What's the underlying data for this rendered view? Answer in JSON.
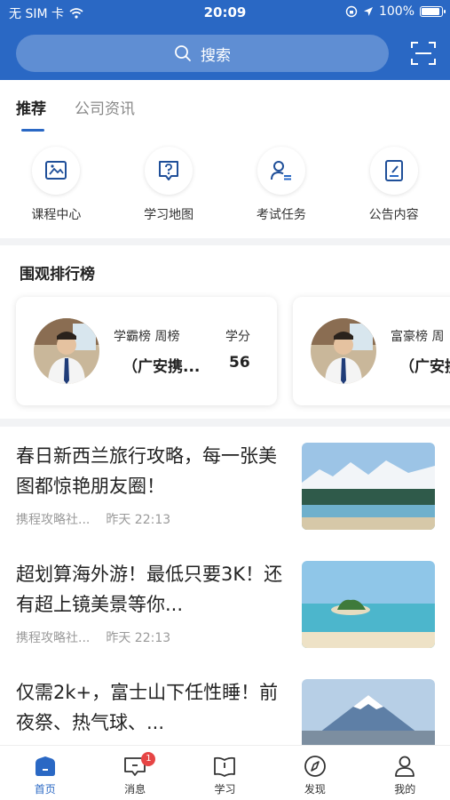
{
  "status_bar": {
    "carrier": "无 SIM 卡",
    "time": "20:09",
    "battery": "100%"
  },
  "search": {
    "label": "搜索"
  },
  "tabs": [
    {
      "label": "推荐",
      "active": true
    },
    {
      "label": "公司资讯",
      "active": false
    }
  ],
  "quick_actions": [
    {
      "label": "课程中心",
      "icon": "image-icon"
    },
    {
      "label": "学习地图",
      "icon": "question-icon"
    },
    {
      "label": "考试任务",
      "icon": "user-list-icon"
    },
    {
      "label": "公告内容",
      "icon": "edit-icon"
    }
  ],
  "ranking": {
    "title": "围观排行榜",
    "cards": [
      {
        "label": "学霸榜 周榜",
        "name": "（广安携...",
        "score_label": "学分",
        "score": "56"
      },
      {
        "label": "富豪榜 周",
        "name": "（广安携"
      }
    ]
  },
  "articles": [
    {
      "title": "春日新西兰旅行攻略，每一张美图都惊艳朋友圈！",
      "source": "携程攻略社...",
      "time": "昨天 22:13"
    },
    {
      "title": "超划算海外游！最低只要3K！还有超上镜美景等你...",
      "source": "携程攻略社...",
      "time": "昨天 22:13"
    },
    {
      "title": "仅需2k+，富士山下任性睡！前夜祭、热气球、..."
    }
  ],
  "bottom_nav": [
    {
      "label": "首页",
      "icon": "home-icon",
      "active": true
    },
    {
      "label": "消息",
      "icon": "message-icon",
      "badge": "1"
    },
    {
      "label": "学习",
      "icon": "book-icon"
    },
    {
      "label": "发现",
      "icon": "compass-icon"
    },
    {
      "label": "我的",
      "icon": "profile-icon"
    }
  ],
  "colors": {
    "primary": "#2a68c4",
    "badge": "#e64545"
  }
}
